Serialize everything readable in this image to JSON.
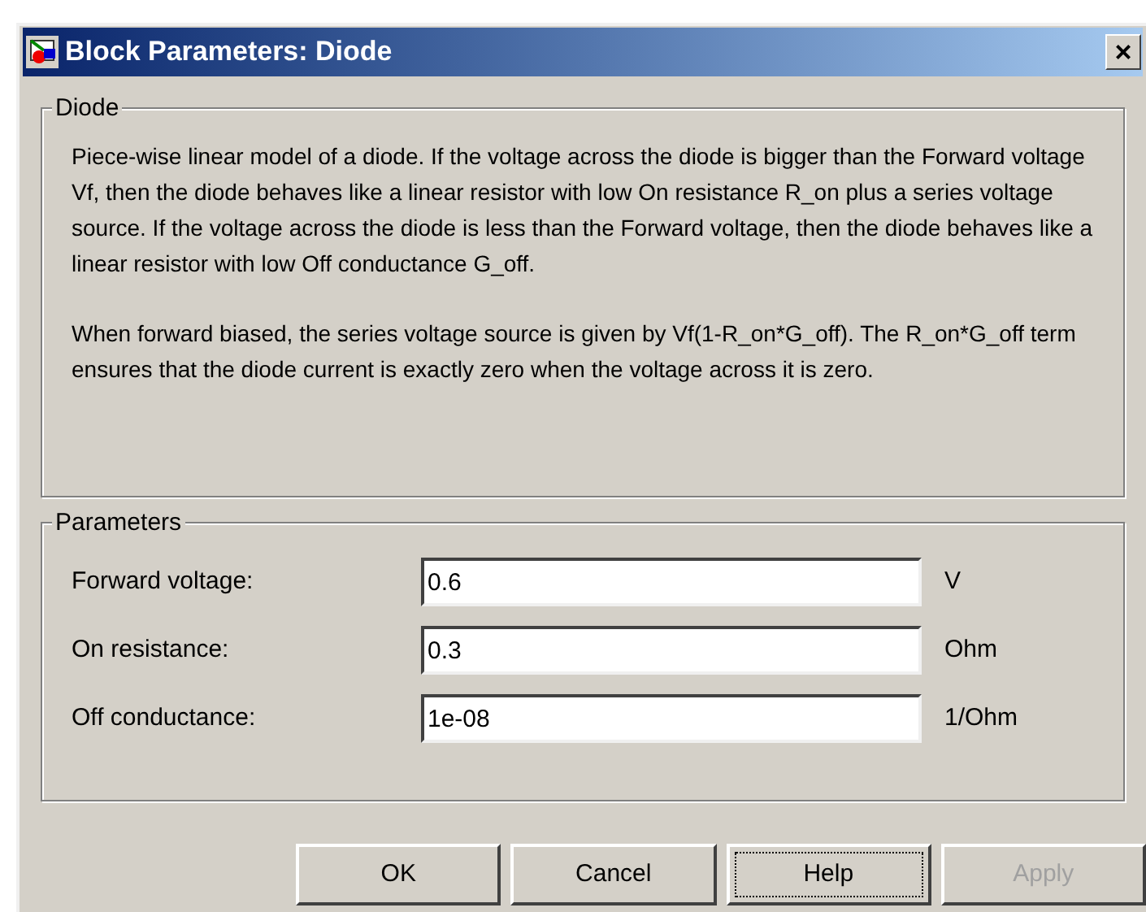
{
  "window": {
    "title": "Block Parameters: Diode",
    "close": "×"
  },
  "description_group": {
    "title": "Diode",
    "paragraphs": [
      "Piece-wise linear model of a diode. If the voltage across the diode is bigger than the Forward voltage Vf, then the diode behaves like a linear resistor with low On resistance R_on plus a series voltage source. If the voltage across the diode is less than the Forward voltage, then the diode behaves like a linear resistor with low Off conductance G_off.",
      "When forward biased, the series voltage source is given by Vf(1-R_on*G_off). The R_on*G_off term ensures that the diode current is exactly zero when the voltage across it is zero."
    ]
  },
  "parameters_group": {
    "title": "Parameters",
    "rows": [
      {
        "label": "Forward voltage:",
        "value": "0.6",
        "unit": "V"
      },
      {
        "label": "On resistance:",
        "value": "0.3",
        "unit": "Ohm"
      },
      {
        "label": "Off conductance:",
        "value": "1e-08",
        "unit": "1/Ohm"
      }
    ]
  },
  "buttons": [
    {
      "label": "OK",
      "disabled": false,
      "focused": false
    },
    {
      "label": "Cancel",
      "disabled": false,
      "focused": false
    },
    {
      "label": "Help",
      "disabled": false,
      "focused": true
    },
    {
      "label": "Apply",
      "disabled": true,
      "focused": false
    }
  ]
}
